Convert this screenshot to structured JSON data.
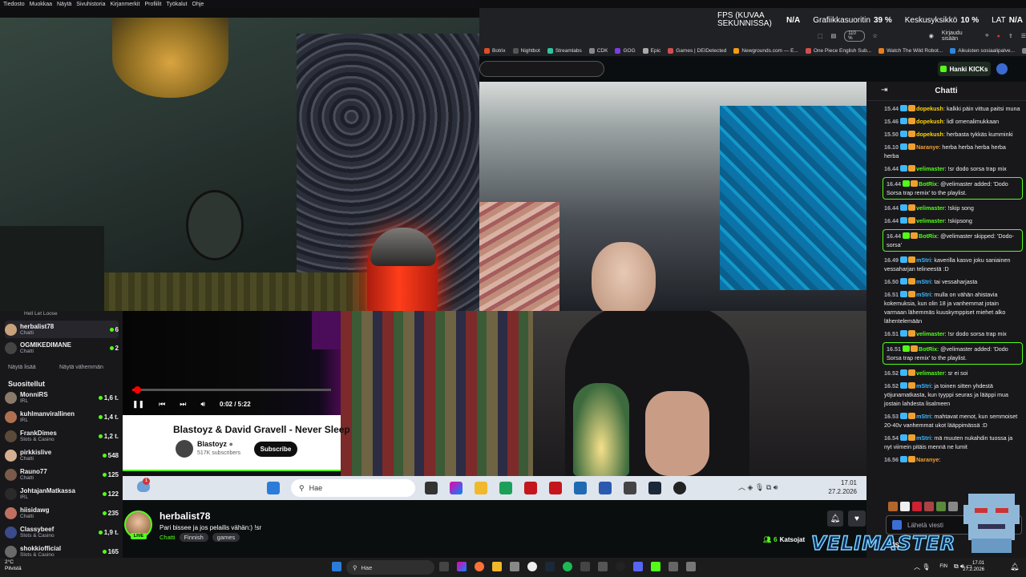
{
  "browser_menu": [
    "Tiedosto",
    "Muokkaa",
    "Näytä",
    "Sivuhistoria",
    "Kirjanmerkit",
    "Profiilit",
    "Työkalut",
    "Ohje"
  ],
  "perf_overlay": {
    "fps_label": "FPS (KUVAA SEKUNNISSA)",
    "fps_value": "N/A",
    "gpu_label": "Grafiikkasuoritin",
    "gpu_value": "39 %",
    "cpu_label": "Keskusyksikkö",
    "cpu_value": "10 %",
    "lat_label": "LAT",
    "lat_value": "N/A"
  },
  "toolbar": {
    "zoom": "110 %",
    "signin": "Kirjaudu sisään"
  },
  "bookmarks": [
    {
      "label": "Botrix",
      "color": "#e34c26"
    },
    {
      "label": "Nightbot",
      "color": "#555555"
    },
    {
      "label": "Streamlabs",
      "color": "#31c3a2"
    },
    {
      "label": "CDK",
      "color": "#888888"
    },
    {
      "label": "GOG",
      "color": "#7b3fe4"
    },
    {
      "label": "Epic",
      "color": "#aaaaaa"
    },
    {
      "label": "Games | DEIDetected",
      "color": "#d14f4f"
    },
    {
      "label": "Newgrounds.com — E...",
      "color": "#f39c12"
    },
    {
      "label": "One Piece English Sub...",
      "color": "#d14f4f"
    },
    {
      "label": "Watch The Wild Robot...",
      "color": "#e67e22"
    },
    {
      "label": "Aikuisten sosiaalipalve...",
      "color": "#2e86de"
    },
    {
      "label": "Muut kirjanmerkit",
      "color": "#888888"
    }
  ],
  "kick": {
    "hanki_kicks": "Hanki KICKs"
  },
  "sidebar": {
    "top_cat": "Hell Let Loose",
    "following": [
      {
        "name": "herbalist78",
        "category": "Chatti",
        "count": "6",
        "color": "#c9a27a"
      },
      {
        "name": "OGMIKEDIMANE",
        "category": "Chatti",
        "count": "2",
        "color": "#444444"
      }
    ],
    "show_more": "Näytä lisää",
    "show_less": "Näytä vähemmän",
    "recommended_header": "Suositellut",
    "recommended": [
      {
        "name": "MonniRS",
        "category": "IRL",
        "count": "1,6 t.",
        "color": "#8a7a6a"
      },
      {
        "name": "kuhlmanvirallinen",
        "category": "IRL",
        "count": "1,4 t.",
        "color": "#b07050"
      },
      {
        "name": "FrankDimes",
        "category": "Slots & Casino",
        "count": "1,2 t.",
        "color": "#5a4a3a"
      },
      {
        "name": "pirkkislive",
        "category": "Chatti",
        "count": "548",
        "color": "#d4b090"
      },
      {
        "name": "Rauno77",
        "category": "Chatti",
        "count": "125",
        "color": "#7a5a4a"
      },
      {
        "name": "JohtajanMatkassa",
        "category": "IRL",
        "count": "122",
        "color": "#2a2a2a"
      },
      {
        "name": "hiisidawg",
        "category": "Chatti",
        "count": "235",
        "color": "#c07060"
      },
      {
        "name": "Classybeef",
        "category": "Slots & Casino",
        "count": "1,9 t.",
        "color": "#3a4a8a"
      },
      {
        "name": "shokkiofficial",
        "category": "Slots & Casino",
        "count": "165",
        "color": "#6a6a6a"
      }
    ]
  },
  "youtube": {
    "time": "0:02 / 5:22",
    "title": "Blastoyz & David Gravell - Never Sleep",
    "channel": "Blastoyz",
    "subscribers": "517K subscribers",
    "subscribe": "Subscribe",
    "progress": 0.006
  },
  "win_taskbar_inner": {
    "search": "Hae",
    "time": "17.01",
    "date": "27.2.2026",
    "badge": "1"
  },
  "stream_info": {
    "name": "herbalist78",
    "title": "Pari bissee ja jos pelailis vähän:) !sr",
    "category": "Chatti",
    "tags": [
      "Finnish",
      "games"
    ],
    "live": "LIVE",
    "viewers_count": "6",
    "viewers_label": "Katsojat"
  },
  "chat": {
    "header": "Chatti",
    "input_placeholder": "Lähetä viesti",
    "messages": [
      {
        "t": "15.44",
        "u": "dopekush",
        "c": "#ffd700",
        "m": "kalkki päin vittua paitsi muna",
        "hl": false
      },
      {
        "t": "15.46",
        "u": "dopekush",
        "c": "#ffd700",
        "m": "lidl omenalimukkaan",
        "hl": false
      },
      {
        "t": "15.50",
        "u": "dopekush",
        "c": "#ffd700",
        "m": "herbasta tykkäs kumminki",
        "hl": false
      },
      {
        "t": "16.10",
        "u": "Naranye",
        "c": "#f0a030",
        "m": "herba herba herba herba herba",
        "hl": false
      },
      {
        "t": "16.44",
        "u": "velimaster",
        "c": "#53fc18",
        "m": "!sr dodo sorsa trap mix",
        "hl": false
      },
      {
        "t": "16.44",
        "u": "BotRix",
        "c": "#53fc18",
        "m": "@velimaster added: 'Dodo Sorsa trap remix' to the playlist.",
        "hl": true
      },
      {
        "t": "16.44",
        "u": "velimaster",
        "c": "#53fc18",
        "m": "!skip song",
        "hl": false
      },
      {
        "t": "16.44",
        "u": "velimaster",
        "c": "#53fc18",
        "m": "!skipsong",
        "hl": false
      },
      {
        "t": "16.44",
        "u": "BotRix",
        "c": "#53fc18",
        "m": "@velimaster skipped: 'Dodo-sorsa'",
        "hl": true
      },
      {
        "t": "16.49",
        "u": "mStri",
        "c": "#3db8ff",
        "m": "kaverilla kasvo joku saniainen vessaharjan telineestä :D",
        "hl": false
      },
      {
        "t": "16.50",
        "u": "mStri",
        "c": "#3db8ff",
        "m": "tai vessaharjasta",
        "hl": false
      },
      {
        "t": "16.51",
        "u": "mStri",
        "c": "#3db8ff",
        "m": "mulla on vähän ahistavia kokemuksia, kun olin 18 ja vanhemmat jotain varmaan lähemmäs kuuskymppiset miehet alko lähentelemään",
        "hl": false
      },
      {
        "t": "16.51",
        "u": "velimaster",
        "c": "#53fc18",
        "m": "!sr dodo sorsa trap mix",
        "hl": false
      },
      {
        "t": "16.51",
        "u": "BotRix",
        "c": "#53fc18",
        "m": "@velimaster added: 'Dodo Sorsa trap remix' to the playlist.",
        "hl": true
      },
      {
        "t": "16.52",
        "u": "velimaster",
        "c": "#53fc18",
        "m": "sr ei soi",
        "hl": false
      },
      {
        "t": "16.52",
        "u": "mStri",
        "c": "#3db8ff",
        "m": "ja toinen sitten yhdestä yöjunamatkasta, kun tyyppi seuras ja lääppi mua jostain lahdesta lisalmeen",
        "hl": false
      },
      {
        "t": "16.53",
        "u": "mStri",
        "c": "#3db8ff",
        "m": "mahtavat menot, kun semmoiset 20-40v vanhemmat ukot lääppimässä :D",
        "hl": false
      },
      {
        "t": "16.54",
        "u": "mStri",
        "c": "#3db8ff",
        "m": "mä muuten nukahdin tuossa ja nyt viimein pitäis mennä ne lumit",
        "hl": false
      },
      {
        "t": "16.56",
        "u": "Naranye",
        "c": "#f0a030",
        "m": "",
        "hl": false
      }
    ]
  },
  "overlay_brand": "VELIMASTER",
  "overlay_small": "JS",
  "taskbar": {
    "weather_temp": "2°C",
    "weather_desc": "Pilvistä",
    "search": "Hae",
    "lang": "FIN",
    "time": "17.01",
    "date": "27.2.2026"
  },
  "colors": {
    "kick_green": "#53fc18",
    "bg": "#0e0e10",
    "panel": "#18181b"
  }
}
